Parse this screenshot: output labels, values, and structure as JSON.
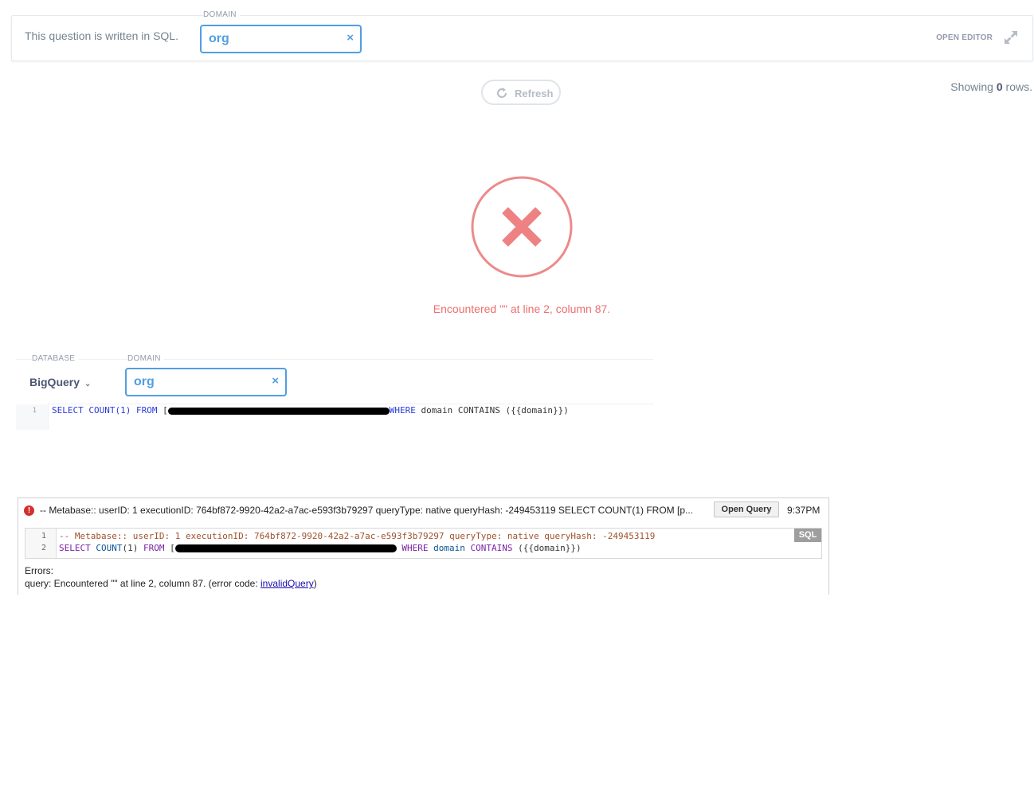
{
  "top_bar": {
    "written_in": "This question is written in SQL.",
    "param_label": "DOMAIN",
    "param_value": "org",
    "clear_glyph": "×",
    "open_editor": "OPEN EDITOR",
    "expand_icon": "expand-arrows-icon"
  },
  "refresh": {
    "label": "Refresh",
    "icon": "refresh-icon"
  },
  "rows": {
    "prefix": "Showing ",
    "count": "0",
    "suffix": " rows."
  },
  "error": {
    "icon": "error-x-icon",
    "message": "Encountered \"\" at line 2, column 87.",
    "color": "#ed6e6e"
  },
  "editor": {
    "database_label": "DATABASE",
    "database_value": "BigQuery",
    "domain_label": "DOMAIN",
    "domain_value": "org",
    "line_number": "1",
    "code": {
      "select": "SELECT",
      "count": "COUNT(1)",
      "from": "FROM",
      "bracket": "[",
      "where": "WHERE",
      "rest": " domain CONTAINS ({{domain}})"
    }
  },
  "log": {
    "header": "-- Metabase:: userID: 1 executionID: 764bf872-9920-42a2-a7ac-e593f3b79297 queryType: native queryHash: -249453119 SELECT COUNT(1) FROM [p...",
    "open_query": "Open Query",
    "time": "9:37PM",
    "sql_badge": "SQL",
    "line1_num": "1",
    "line2_num": "2",
    "line1": "-- Metabase:: userID: 1 executionID: 764bf872-9920-42a2-a7ac-e593f3b79297 queryType: native queryHash: -249453119",
    "line2": {
      "select": "SELECT",
      "count": "COUNT",
      "count_args": "(1)",
      "from": "FROM",
      "bracket": "[",
      "where": "WHERE",
      "domain": "domain",
      "contains": "CONTAINS",
      "tail": "({{domain}})"
    },
    "errors_label": "Errors:",
    "error_text": "query: Encountered \"\" at line 2, column 87. (error code: ",
    "error_code": "invalidQuery",
    "error_close": ")"
  }
}
